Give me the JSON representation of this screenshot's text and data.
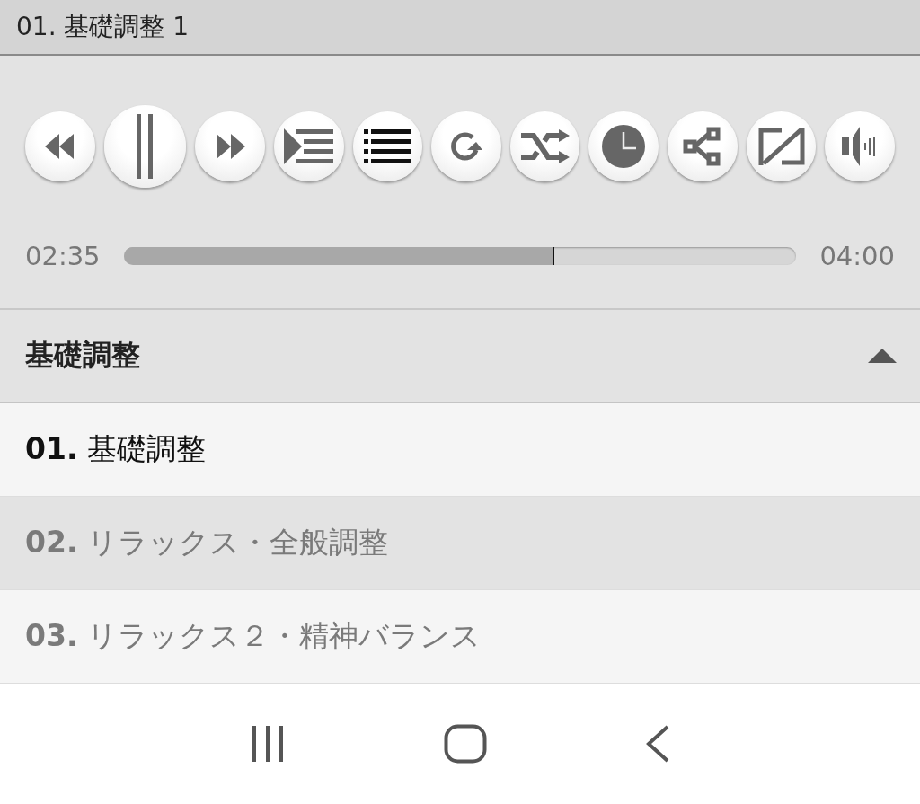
{
  "title_bar": {
    "title": "01. 基礎調整 1"
  },
  "controls": [
    {
      "kind": "rewind"
    },
    {
      "kind": "pause"
    },
    {
      "kind": "forward"
    },
    {
      "kind": "playlist"
    },
    {
      "kind": "list"
    },
    {
      "kind": "repeat"
    },
    {
      "kind": "shuffle"
    },
    {
      "kind": "clock"
    },
    {
      "kind": "tree"
    },
    {
      "kind": "resize"
    },
    {
      "kind": "volume"
    }
  ],
  "progress": {
    "elapsed": "02:35",
    "total": "04:00",
    "level": 0.64
  },
  "section": {
    "title": "基礎調整",
    "expanded": true
  },
  "tracks": [
    {
      "label": "**01.** 基礎調整",
      "selected": true
    },
    {
      "label": "**02.** リラックス・全般調整",
      "selected": false
    },
    {
      "label": "**03.** リラックス２・精神バランス",
      "selected": false
    }
  ]
}
